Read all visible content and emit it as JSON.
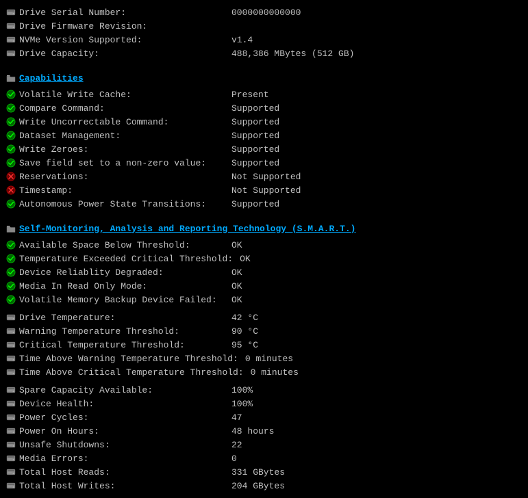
{
  "rows": [
    {
      "id": "drive-serial",
      "icon": "drive",
      "label": "Drive Serial Number:",
      "value": "0000000000000"
    },
    {
      "id": "drive-firmware",
      "icon": "drive",
      "label": "Drive Firmware Revision:",
      "value": ""
    },
    {
      "id": "nvme-version",
      "icon": "drive",
      "label": "NVMe Version Supported:",
      "value": "v1.4"
    },
    {
      "id": "drive-capacity",
      "icon": "drive",
      "label": "Drive Capacity:",
      "value": "488,386 MBytes (512 GB)"
    }
  ],
  "capabilities_header": "Capabilities",
  "capabilities": [
    {
      "id": "volatile-write-cache",
      "icon": "green",
      "label": "Volatile Write Cache:",
      "value": "Present"
    },
    {
      "id": "compare-command",
      "icon": "green",
      "label": "Compare Command:",
      "value": "Supported"
    },
    {
      "id": "write-uncorrectable",
      "icon": "green",
      "label": "Write Uncorrectable Command:",
      "value": "Supported"
    },
    {
      "id": "dataset-management",
      "icon": "green",
      "label": "Dataset Management:",
      "value": "Supported"
    },
    {
      "id": "write-zeroes",
      "icon": "green",
      "label": "Write Zeroes:",
      "value": "Supported"
    },
    {
      "id": "save-field",
      "icon": "green",
      "label": "Save field set to a non-zero value:",
      "value": "Supported"
    },
    {
      "id": "reservations",
      "icon": "red",
      "label": "Reservations:",
      "value": "Not Supported"
    },
    {
      "id": "timestamp",
      "icon": "red",
      "label": "Timestamp:",
      "value": "Not Supported"
    },
    {
      "id": "autonomous-power",
      "icon": "green",
      "label": "Autonomous Power State Transitions:",
      "value": "Supported"
    }
  ],
  "smart_header": "Self-Monitoring, Analysis and Reporting Technology (S.M.A.R.T.)",
  "smart": [
    {
      "id": "available-space",
      "icon": "green",
      "label": "Available Space Below Threshold:",
      "value": "OK"
    },
    {
      "id": "temp-exceeded",
      "icon": "green",
      "label": "Temperature Exceeded Critical Threshold:",
      "value": "OK"
    },
    {
      "id": "device-reliability",
      "icon": "green",
      "label": "Device Reliablity Degraded:",
      "value": "OK"
    },
    {
      "id": "media-readonly",
      "icon": "green",
      "label": "Media In Read Only Mode:",
      "value": "OK"
    },
    {
      "id": "volatile-memory",
      "icon": "green",
      "label": "Volatile Memory Backup Device Failed:",
      "value": "OK"
    }
  ],
  "temperatures": [
    {
      "id": "drive-temp",
      "icon": "drive",
      "label": "Drive Temperature:",
      "value": "42 °C"
    },
    {
      "id": "warning-temp",
      "icon": "drive",
      "label": "Warning Temperature Threshold:",
      "value": "90 °C"
    },
    {
      "id": "critical-temp",
      "icon": "drive",
      "label": "Critical Temperature Threshold:",
      "value": "95 °C"
    },
    {
      "id": "time-above-warning",
      "icon": "drive",
      "label": "Time Above Warning Temperature Threshold:",
      "value": "0 minutes"
    },
    {
      "id": "time-above-critical",
      "icon": "drive",
      "label": "Time Above Critical Temperature Threshold:",
      "value": "0 minutes"
    }
  ],
  "health": [
    {
      "id": "spare-capacity",
      "icon": "drive",
      "label": "Spare Capacity Available:",
      "value": "100%"
    },
    {
      "id": "device-health",
      "icon": "drive",
      "label": "Device Health:",
      "value": "100%"
    },
    {
      "id": "power-cycles",
      "icon": "drive",
      "label": "Power Cycles:",
      "value": "47"
    },
    {
      "id": "power-on-hours",
      "icon": "drive",
      "label": "Power On Hours:",
      "value": "48 hours"
    },
    {
      "id": "unsafe-shutdowns",
      "icon": "drive",
      "label": "Unsafe Shutdowns:",
      "value": "22"
    },
    {
      "id": "media-errors",
      "icon": "drive",
      "label": "Media Errors:",
      "value": "0"
    },
    {
      "id": "total-host-reads",
      "icon": "drive",
      "label": "Total Host Reads:",
      "value": "331 GBytes"
    },
    {
      "id": "total-host-writes",
      "icon": "drive",
      "label": "Total Host Writes:",
      "value": "204 GBytes"
    }
  ],
  "icons": {
    "drive": "🖴",
    "green": "✔",
    "red": "✘",
    "folder": "📁"
  }
}
